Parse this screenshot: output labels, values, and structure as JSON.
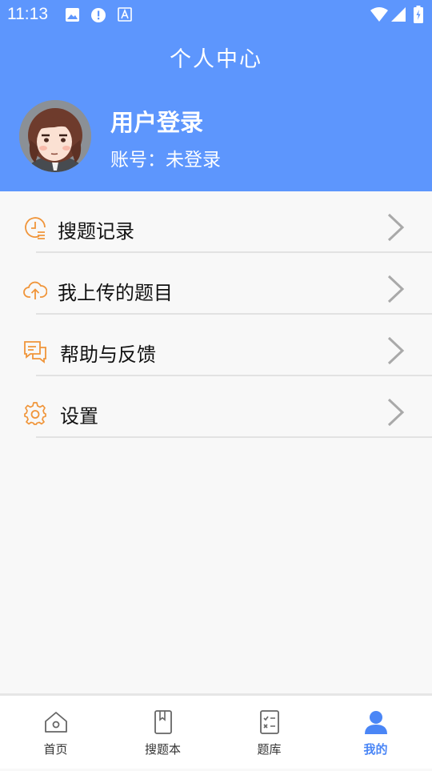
{
  "status_bar": {
    "time": "11:13"
  },
  "header": {
    "title": "个人中心",
    "user_name": "用户登录",
    "account_text": "账号：未登录"
  },
  "menu": [
    {
      "label": "搜题记录",
      "icon": "clock-list-icon"
    },
    {
      "label": "我上传的题目",
      "icon": "cloud-upload-icon"
    },
    {
      "label": "帮助与反馈",
      "icon": "chat-bubbles-icon"
    },
    {
      "label": "设置",
      "icon": "gear-icon"
    }
  ],
  "tabs": [
    {
      "label": "首页",
      "icon": "home-icon",
      "active": false
    },
    {
      "label": "搜题本",
      "icon": "notebook-icon",
      "active": false
    },
    {
      "label": "题库",
      "icon": "checklist-icon",
      "active": false
    },
    {
      "label": "我的",
      "icon": "person-icon",
      "active": true
    }
  ],
  "colors": {
    "header_bg": "#5d96fd",
    "menu_icon": "#f0953a",
    "active_tab": "#4a86f6"
  }
}
